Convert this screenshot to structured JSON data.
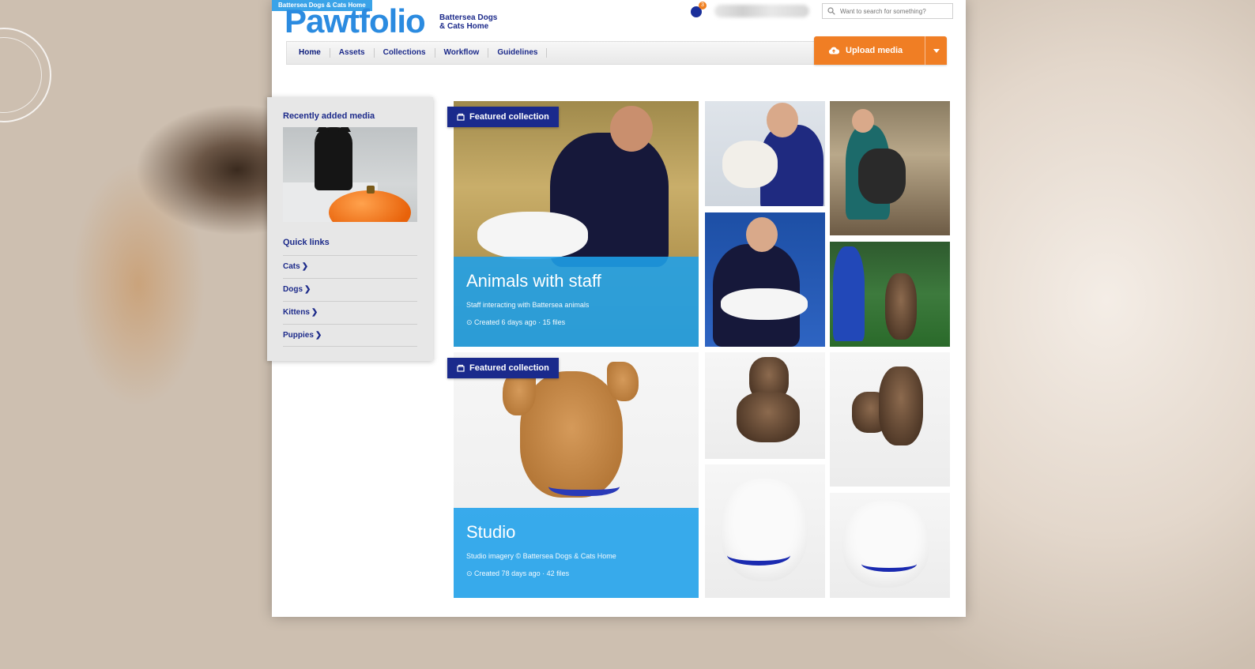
{
  "header": {
    "banner": "Battersea Dogs & Cats Home",
    "logo": "Pawtfolio",
    "brand_line1": "Battersea Dogs",
    "brand_line2": "& Cats Home",
    "notification_count": "3",
    "search_placeholder": "Want to search for something?"
  },
  "nav": {
    "items": [
      {
        "label": "Home"
      },
      {
        "label": "Assets"
      },
      {
        "label": "Collections"
      },
      {
        "label": "Workflow"
      },
      {
        "label": "Guidelines"
      }
    ],
    "upload_label": "Upload media"
  },
  "sidebar": {
    "recent_heading": "Recently added media",
    "quick_heading": "Quick links",
    "links": [
      {
        "label": "Cats"
      },
      {
        "label": "Dogs"
      },
      {
        "label": "Kittens"
      },
      {
        "label": "Puppies"
      }
    ]
  },
  "collections": [
    {
      "badge": "Featured collection",
      "title": "Animals with staff",
      "description": "Staff interacting with Battersea animals",
      "meta": "⊙ Created 6 days ago · 15 files"
    },
    {
      "badge": "Featured collection",
      "title": "Studio",
      "description": "Studio imagery © Battersea Dogs & Cats Home",
      "meta": "⊙ Created 78 days ago · 42 files"
    }
  ],
  "colors": {
    "brand_blue": "#2b8be0",
    "navy": "#1a2a8c",
    "overlay_blue": "#1ea0eb",
    "upload_orange": "#f07e24"
  }
}
